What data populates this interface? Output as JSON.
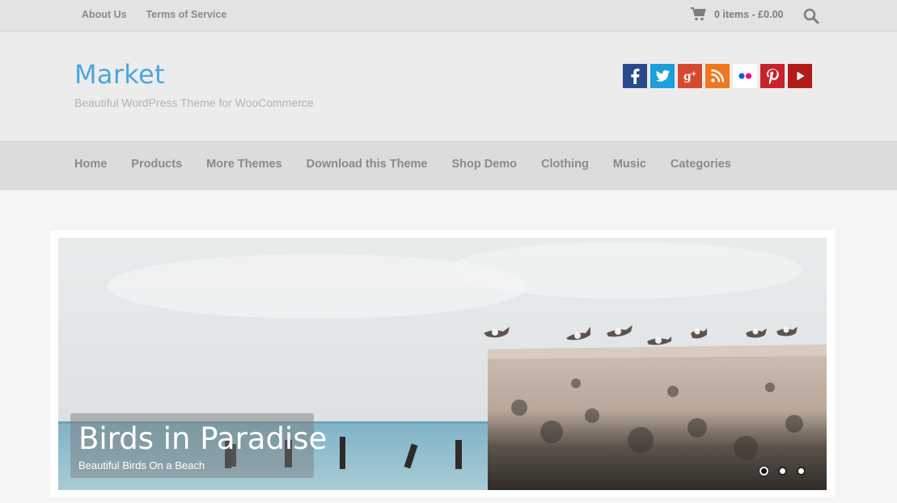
{
  "topbar": {
    "links": [
      "About Us",
      "Terms of Service"
    ],
    "cart_text": "0 items - £0.00",
    "cart_icon": "cart-icon",
    "search_icon": "search-icon"
  },
  "header": {
    "site_title": "Market",
    "site_description": "Beautiful WordPress Theme for WooCommerce",
    "social": [
      {
        "name": "facebook",
        "glyph": "f",
        "color": "#3b5998"
      },
      {
        "name": "twitter",
        "glyph": "t",
        "color": "#1da1f2"
      },
      {
        "name": "google-plus",
        "glyph": "g+",
        "color": "#dd4b39"
      },
      {
        "name": "rss",
        "glyph": "rss",
        "color": "#f26522"
      },
      {
        "name": "flickr",
        "glyph": "••",
        "color": "#ffffff"
      },
      {
        "name": "pinterest",
        "glyph": "p",
        "color": "#cb2027"
      },
      {
        "name": "youtube",
        "glyph": "▶",
        "color": "#b31217"
      }
    ]
  },
  "nav": {
    "items": [
      "Home",
      "Products",
      "More Themes",
      "Download this Theme",
      "Shop Demo",
      "Clothing",
      "Music",
      "Categories"
    ]
  },
  "slider": {
    "caption_title": "Birds in Paradise",
    "caption_subtitle": "Beautiful Birds On a Beach",
    "dots": 3,
    "active_dot": 0
  },
  "colors": {
    "accent": "#4aa7df"
  }
}
